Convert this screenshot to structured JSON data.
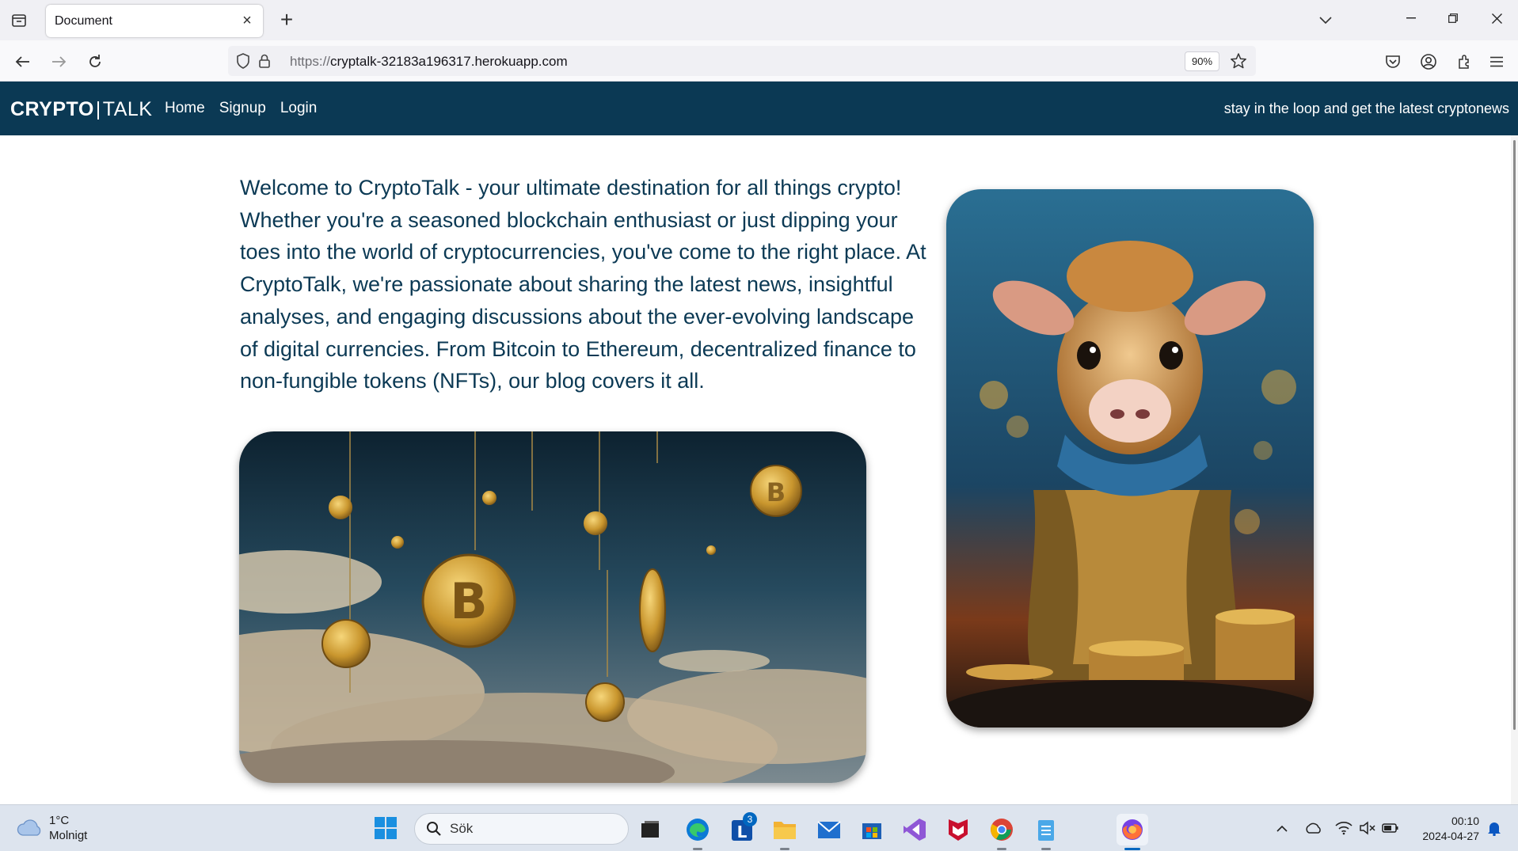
{
  "browser": {
    "tab": {
      "title": "Document"
    },
    "url": {
      "protocol": "https://",
      "host": "cryptalk-32183a196317.herokuapp.com"
    },
    "zoom": "90%"
  },
  "site": {
    "logo": {
      "bold": "CRYPTO",
      "separator": "|",
      "light": "TALK"
    },
    "nav": [
      {
        "label": "Home"
      },
      {
        "label": "Signup"
      },
      {
        "label": "Login"
      }
    ],
    "tagline": "stay in the loop and get the latest cryptonews"
  },
  "main": {
    "intro": "Welcome to CryptoTalk - your ultimate destination for all things crypto! Whether you're a seasoned blockchain enthusiast or just dipping your toes into the world of cryptocurrencies, you've come to the right place. At CryptoTalk, we're passionate about sharing the latest news, insightful analyses, and engaging discussions about the ever-evolving landscape of digital currencies. From Bitcoin to Ethereum, decentralized finance to non-fungible tokens (NFTs), our blog covers it all."
  },
  "taskbar": {
    "weather": {
      "temp": "1°C",
      "condition": "Molnigt"
    },
    "search_placeholder": "Sök",
    "apps": [
      {
        "name": "file-explorer-dark"
      },
      {
        "name": "edge"
      },
      {
        "name": "lync",
        "badge": "3"
      },
      {
        "name": "file-explorer"
      },
      {
        "name": "mail"
      },
      {
        "name": "store"
      },
      {
        "name": "visual-studio"
      },
      {
        "name": "mcafee"
      },
      {
        "name": "chrome"
      },
      {
        "name": "notepad"
      },
      {
        "name": "firefox"
      }
    ],
    "clock": {
      "time": "00:10",
      "date": "2024-04-27"
    }
  },
  "colors": {
    "header_bg": "#0b3954",
    "text_primary": "#0b3954",
    "accent": "#0067c0"
  }
}
